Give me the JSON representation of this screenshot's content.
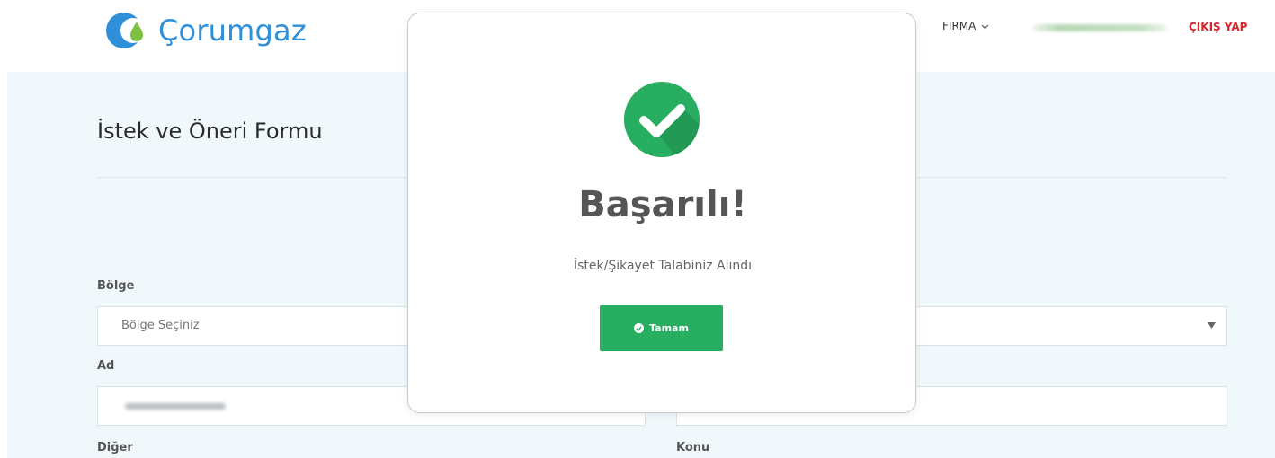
{
  "header": {
    "brand": "Çorumgaz",
    "nav_firma": "FIRMA",
    "nav_logout": "ÇIKIŞ YAP"
  },
  "form": {
    "title": "İstek ve Öneri Formu",
    "region_label": "Bölge",
    "region_placeholder": "Bölge Seçiniz",
    "name_label": "Ad",
    "other_label": "Diğer",
    "subject_label": "Konu"
  },
  "modal": {
    "title": "Başarılı!",
    "message": "İstek/Şikayet Talabiniz Alındı",
    "ok_label": "Tamam"
  },
  "colors": {
    "brand_blue": "#2f8fd8",
    "success_green": "#27ae60",
    "logout_red": "#d6262b",
    "page_bg": "#f1f8fb"
  },
  "icons": {
    "logo": "droplet-logo-icon",
    "firma_dropdown": "chevron-down-icon",
    "success": "check-circle-icon",
    "ok_button": "check-icon",
    "select_arrow": "triangle-down-icon"
  }
}
